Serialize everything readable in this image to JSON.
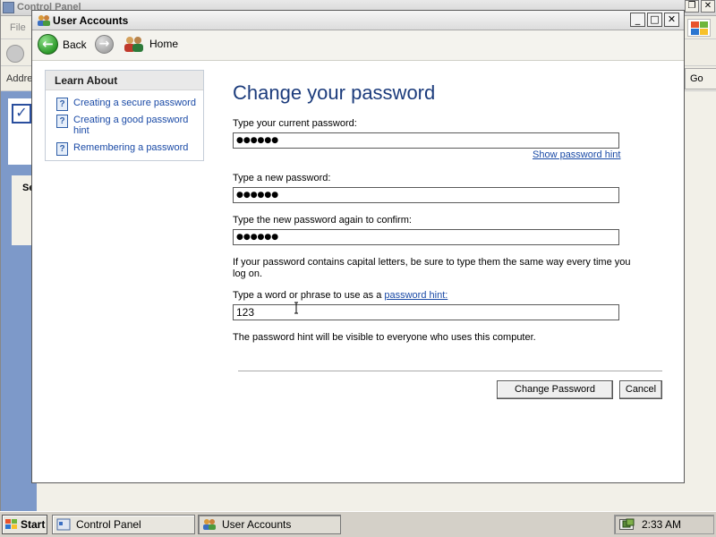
{
  "background_window": {
    "title": "Control Panel",
    "menu_first": "File",
    "address_label": "Addre",
    "go_label": "Go",
    "panel_label": "Se"
  },
  "window": {
    "title": "User Accounts",
    "controls": {
      "minimize": "_",
      "maximize": "□",
      "close": "✕"
    }
  },
  "nav": {
    "back_label": "Back",
    "home_label": "Home"
  },
  "learn_about": {
    "heading": "Learn About",
    "items": [
      {
        "label": "Creating a secure password",
        "icon": "help-icon"
      },
      {
        "label": "Creating a good password hint",
        "icon": "help-icon"
      },
      {
        "label": "Remembering a password",
        "icon": "help-icon"
      }
    ]
  },
  "form": {
    "title": "Change your password",
    "current_label": "Type your current password:",
    "current_value": "●●●●●●",
    "show_hint_link": "Show password hint",
    "new_label": "Type a new password:",
    "new_value": "●●●●●●",
    "confirm_label": "Type the new password again to confirm:",
    "confirm_value": "●●●●●●",
    "caps_note": "If your password contains capital letters, be sure to type them the same way every time you log on.",
    "hint_label_prefix": "Type a word or phrase to use as a ",
    "hint_label_link": "password hint:",
    "hint_value": "123",
    "hint_note": "The password hint will be visible to everyone who uses this computer.",
    "submit_label": "Change Password",
    "cancel_label": "Cancel"
  },
  "taskbar": {
    "start_label": "Start",
    "tasks": [
      {
        "label": "Control Panel",
        "active": false
      },
      {
        "label": "User Accounts",
        "active": true
      }
    ],
    "clock": "2:33 AM"
  },
  "colors": {
    "title_blue": "#1c3c7c",
    "link_blue": "#1a4aa6",
    "back_green": "#2d9a2a"
  }
}
